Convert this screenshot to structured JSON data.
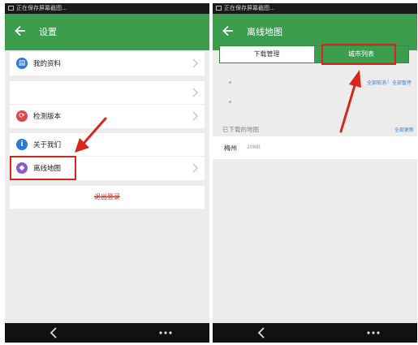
{
  "left_screen": {
    "status_text": "正在保存屏幕截图...",
    "title": "设置",
    "group1": [
      {
        "label": "我的资料",
        "icon": "profile-icon",
        "color": "#2a7bd6"
      }
    ],
    "group2": [
      {
        "label": "",
        "icon": "",
        "color": ""
      },
      {
        "label": "检测版本",
        "icon": "update-icon",
        "color": "#e04848"
      }
    ],
    "group3": [
      {
        "label": "关于我们",
        "icon": "info-icon",
        "color": "#2a7bd6"
      },
      {
        "label": "离线地图",
        "icon": "offline-map-icon",
        "color": "#8a5cc7"
      }
    ],
    "logout_label": "退出登录"
  },
  "right_screen": {
    "status_text": "正在保存屏幕截图...",
    "title": "离线地图",
    "tabs": [
      "下载管理",
      "城市列表"
    ],
    "link_cancel_all": "全部取消",
    "link_separator": "|",
    "link_pause_all": "全部暂停",
    "downloaded_heading": "已下载的地图",
    "downloaded_action": "全部更新",
    "city": {
      "name": "梅州",
      "size": "20MB"
    }
  },
  "colors": {
    "brand_green": "#3d9d4f",
    "highlight_red": "#d9261c",
    "background": "#ececec"
  }
}
